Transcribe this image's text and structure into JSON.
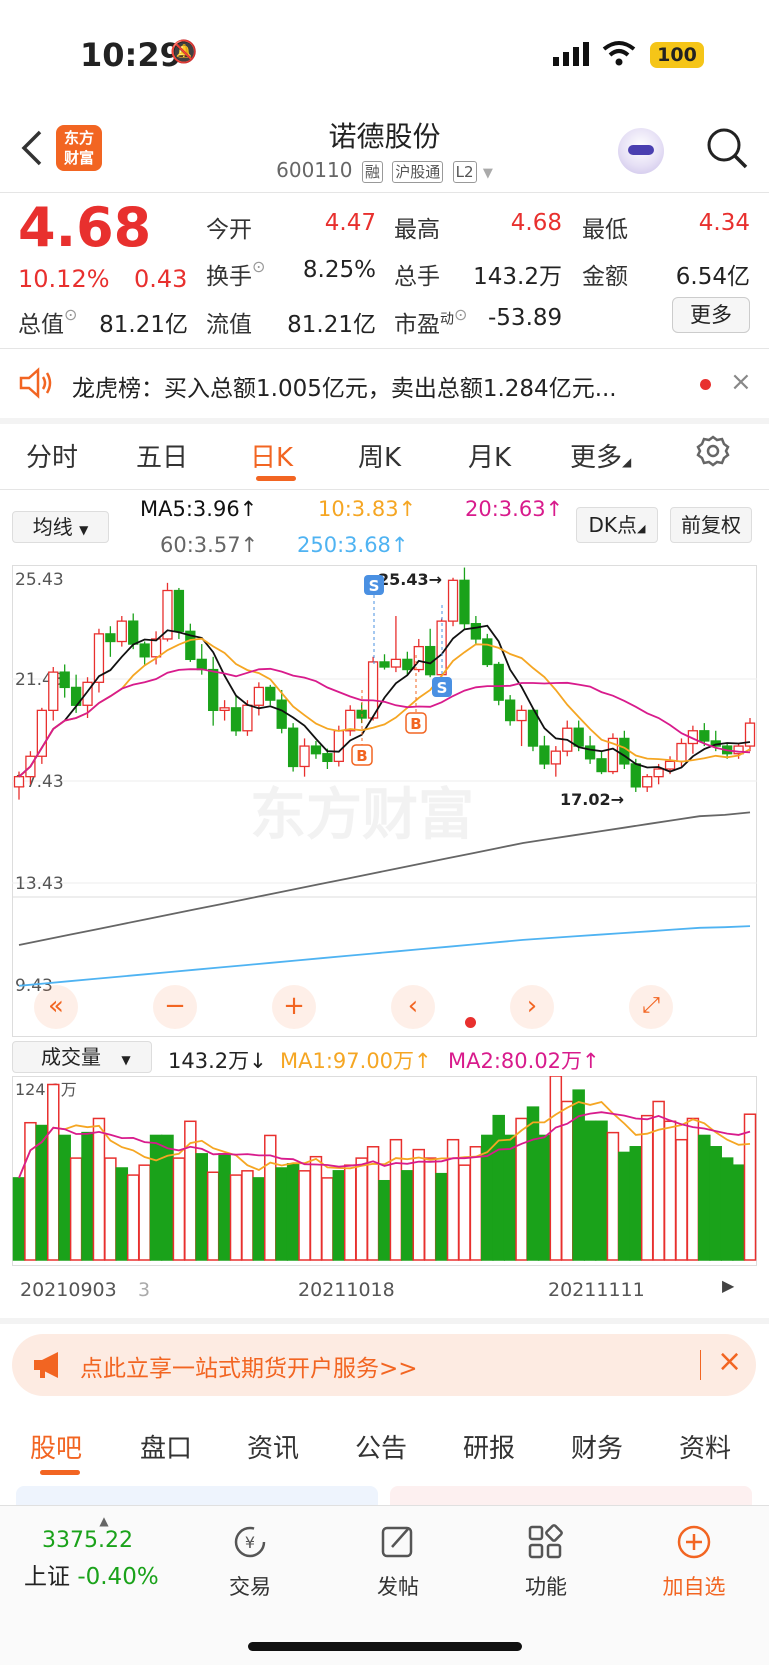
{
  "status_bar": {
    "time": "10:29",
    "battery": "100"
  },
  "header": {
    "logo_line1": "东方",
    "logo_line2": "财富",
    "title": "诺德股份",
    "code": "600110",
    "tags": [
      "融",
      "沪股通",
      "L2"
    ]
  },
  "quote": {
    "price": "4.68",
    "change_pct": "10.12%",
    "change": "0.43",
    "open_label": "今开",
    "open": "4.47",
    "high_label": "最高",
    "high": "4.68",
    "low_label": "最低",
    "low": "4.34",
    "turnover_label": "换手",
    "turnover": "8.25%",
    "volume_label": "总手",
    "volume": "143.2万",
    "amount_label": "金额",
    "amount": "6.54亿",
    "mcap_label": "总值",
    "mcap": "81.21亿",
    "float_label": "流值",
    "float_cap": "81.21亿",
    "pe_label": "市盈",
    "pe_sup": "动",
    "pe": "-53.89",
    "more_button": "更多"
  },
  "notice": {
    "text": "龙虎榜：买入总额1.005亿元，卖出总额1.284亿元..."
  },
  "chart_tabs": {
    "items": [
      "分时",
      "五日",
      "日K",
      "周K",
      "月K",
      "更多"
    ],
    "active": "日K"
  },
  "chart_controls": {
    "ma_select": "均线",
    "ma5": "MA5:3.96↑",
    "ma10": "10:3.83↑",
    "ma20": "20:3.63↑",
    "ma60": "60:3.57↑",
    "ma250": "250:3.68↑",
    "dk_button": "DK点",
    "adjust_button": "前复权"
  },
  "chart_data": {
    "type": "candlestick",
    "y_ticks": [
      "25.43",
      "21.43",
      "17.43",
      "13.43",
      "9.43"
    ],
    "high_annotation": "25.43→",
    "low_annotation": "17.02→",
    "markers": [
      "S",
      "S",
      "B",
      "B"
    ],
    "ohlc": [
      [
        17.2,
        17.8,
        16.7,
        17.6
      ],
      [
        17.6,
        18.6,
        17.3,
        18.4
      ],
      [
        18.4,
        20.3,
        18.1,
        20.2
      ],
      [
        20.2,
        21.9,
        19.8,
        21.7
      ],
      [
        21.7,
        22.0,
        20.7,
        21.1
      ],
      [
        21.1,
        21.6,
        20.1,
        20.4
      ],
      [
        20.4,
        21.5,
        19.9,
        21.3
      ],
      [
        21.3,
        23.4,
        20.9,
        23.2
      ],
      [
        23.2,
        23.5,
        22.3,
        22.9
      ],
      [
        22.9,
        23.9,
        22.7,
        23.7
      ],
      [
        23.7,
        24.0,
        22.6,
        22.8
      ],
      [
        22.8,
        22.9,
        22.0,
        22.3
      ],
      [
        22.3,
        23.3,
        22.0,
        23.0
      ],
      [
        23.0,
        25.2,
        22.9,
        24.9
      ],
      [
        24.9,
        25.0,
        23.0,
        23.3
      ],
      [
        23.3,
        23.6,
        22.1,
        22.2
      ],
      [
        22.2,
        22.8,
        21.6,
        21.8
      ],
      [
        21.8,
        22.3,
        19.6,
        20.2
      ],
      [
        20.2,
        20.6,
        19.8,
        20.3
      ],
      [
        20.3,
        20.8,
        19.2,
        19.4
      ],
      [
        19.4,
        20.6,
        19.2,
        20.4
      ],
      [
        20.4,
        21.3,
        20.0,
        21.1
      ],
      [
        21.1,
        21.2,
        20.4,
        20.6
      ],
      [
        20.6,
        21.0,
        19.3,
        19.5
      ],
      [
        19.5,
        19.7,
        17.8,
        18.0
      ],
      [
        18.0,
        19.1,
        17.6,
        18.8
      ],
      [
        18.8,
        19.0,
        18.3,
        18.5
      ],
      [
        18.5,
        18.7,
        17.9,
        18.2
      ],
      [
        18.2,
        19.6,
        18.0,
        19.4
      ],
      [
        19.4,
        20.4,
        19.2,
        20.2
      ],
      [
        20.2,
        20.5,
        19.7,
        19.9
      ],
      [
        19.9,
        22.3,
        19.8,
        22.1
      ],
      [
        22.1,
        22.4,
        21.8,
        21.9
      ],
      [
        21.9,
        23.9,
        21.7,
        22.2
      ],
      [
        22.2,
        22.5,
        21.6,
        21.8
      ],
      [
        21.8,
        23.0,
        21.7,
        22.7
      ],
      [
        22.7,
        23.4,
        21.5,
        21.6
      ],
      [
        21.6,
        23.8,
        21.5,
        23.7
      ],
      [
        23.7,
        25.4,
        23.5,
        25.3
      ],
      [
        25.3,
        25.8,
        23.4,
        23.6
      ],
      [
        23.6,
        23.9,
        22.8,
        23.0
      ],
      [
        23.0,
        23.2,
        21.9,
        22.0
      ],
      [
        22.0,
        22.1,
        20.4,
        20.6
      ],
      [
        20.6,
        20.8,
        19.6,
        19.8
      ],
      [
        19.8,
        20.4,
        18.8,
        20.2
      ],
      [
        20.2,
        20.3,
        18.6,
        18.8
      ],
      [
        18.8,
        19.2,
        17.9,
        18.1
      ],
      [
        18.1,
        18.8,
        17.6,
        18.6
      ],
      [
        18.6,
        19.8,
        18.4,
        19.5
      ],
      [
        19.5,
        19.8,
        18.6,
        18.8
      ],
      [
        18.8,
        19.2,
        18.1,
        18.3
      ],
      [
        18.3,
        18.6,
        17.7,
        17.8
      ],
      [
        17.8,
        19.3,
        17.7,
        19.1
      ],
      [
        19.1,
        19.4,
        17.9,
        18.1
      ],
      [
        18.1,
        18.3,
        17.0,
        17.2
      ],
      [
        17.2,
        17.7,
        17.0,
        17.6
      ],
      [
        17.6,
        18.1,
        17.3,
        17.9
      ],
      [
        17.9,
        18.4,
        17.7,
        18.2
      ],
      [
        18.2,
        19.1,
        18.0,
        18.9
      ],
      [
        18.9,
        19.6,
        18.5,
        19.4
      ],
      [
        19.4,
        19.7,
        18.8,
        19.0
      ],
      [
        19.0,
        19.4,
        18.6,
        18.8
      ],
      [
        18.8,
        18.9,
        18.3,
        18.5
      ],
      [
        18.5,
        18.9,
        18.3,
        18.8
      ],
      [
        18.8,
        19.9,
        18.6,
        19.7
      ]
    ],
    "long_ma": [
      15.8,
      16.0,
      16.2,
      16.4,
      16.6,
      16.8,
      17.0,
      17.2,
      17.4,
      17.6,
      17.8,
      18.0,
      18.2,
      18.4,
      18.6,
      18.8,
      19.0,
      19.2,
      19.4,
      19.6,
      19.8,
      19.95,
      20.1,
      20.25,
      20.4,
      20.55,
      20.7,
      20.85,
      20.9,
      21.0
    ],
    "volume_label_ticks": [
      "124.1万"
    ],
    "x_labels": [
      "20210903",
      "3",
      "20211018",
      "20211111"
    ]
  },
  "chart_toolbar": [
    "«",
    "−",
    "+",
    "‹",
    "›",
    "⤢"
  ],
  "volume_header": {
    "select": "成交量",
    "value": "143.2万↓",
    "ma1": "MA1:97.00万↑",
    "ma2": "MA2:80.02万↑"
  },
  "volume_data": {
    "values": [
      58,
      97,
      95,
      124,
      88,
      72,
      90,
      100,
      72,
      65,
      60,
      67,
      88,
      88,
      72,
      98,
      75,
      62,
      75,
      60,
      63,
      58,
      88,
      65,
      68,
      63,
      73,
      58,
      63,
      67,
      72,
      80,
      56,
      85,
      63,
      78,
      72,
      61,
      85,
      67,
      80,
      88,
      102,
      88,
      100,
      108,
      88,
      130,
      112,
      120,
      98,
      98,
      90,
      76,
      80,
      102,
      112,
      98,
      85,
      100,
      88,
      80,
      72,
      67,
      103
    ],
    "up": [
      false,
      true,
      false,
      true,
      false,
      true,
      false,
      true,
      true,
      false,
      true,
      true,
      false,
      false,
      true,
      true,
      false,
      true,
      false,
      true,
      true,
      false,
      true,
      false,
      false,
      true,
      true,
      true,
      false,
      true,
      true,
      true,
      false,
      true,
      false,
      true,
      true,
      false,
      true,
      true,
      true,
      false,
      false,
      false,
      true,
      false,
      false,
      true,
      true,
      false,
      false,
      false,
      true,
      false,
      false,
      true,
      true,
      true,
      true,
      true,
      false,
      false,
      false,
      false,
      true
    ]
  },
  "promo": {
    "text": "点此立享一站式期货开户服务>>"
  },
  "bottom_tabs": {
    "items": [
      "股吧",
      "盘口",
      "资讯",
      "公告",
      "研报",
      "财务",
      "资料"
    ],
    "active": "股吧"
  },
  "bottom_nav": {
    "index_value": "3375.22",
    "index_name": "上证",
    "index_change": "-0.40%",
    "trade": "交易",
    "post": "发帖",
    "functions": "功能",
    "add_watch": "加自选"
  },
  "colors": {
    "up": "#e8302e",
    "down": "#1aa21a",
    "accent": "#f26522",
    "ma5": "#111111",
    "ma10": "#f5a623",
    "ma20": "#d81b8c",
    "ma60": "#666666",
    "ma250": "#4fb3f2"
  }
}
